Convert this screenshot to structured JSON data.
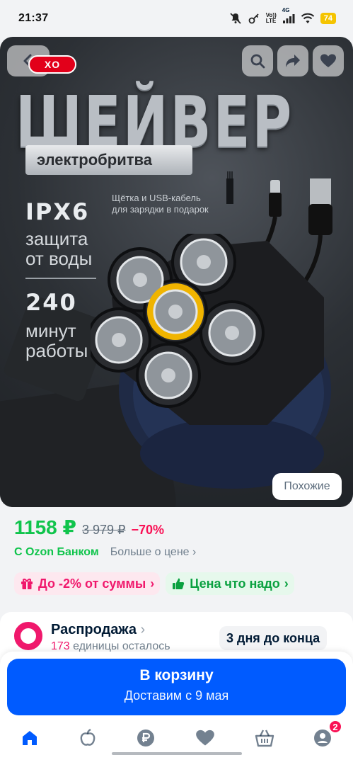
{
  "status_bar": {
    "time": "21:37",
    "network_top": "Vo))",
    "network_bottom": "LTE",
    "network_type": "4G",
    "battery": "74",
    "icons": [
      "mute-icon",
      "key-icon",
      "signal-icon",
      "wifi-icon",
      "battery-icon"
    ]
  },
  "product_image": {
    "brand": "XO",
    "title": "ШЕЙВЕР",
    "subtitle": "электробритва",
    "gift_note": "Щётка и USB-кабель для зарядки в подарок",
    "spec1_big": "IPX6",
    "spec1_line1": "защита",
    "spec1_line2": "от воды",
    "spec2_big": "240",
    "spec2_line1": "минут",
    "spec2_line2": "работы",
    "similar_label": "Похожие",
    "buttons": [
      "back-icon",
      "search-icon",
      "share-icon",
      "heart-icon"
    ]
  },
  "price": {
    "current": "1158 ₽",
    "old": "3 979 ₽",
    "discount": "−70%",
    "ozon_bank": "С Ozon Банком",
    "more": "Больше о цене"
  },
  "chips": [
    {
      "label": "До -2% от суммы",
      "icon": "gift-icon",
      "color": "#f0186c"
    },
    {
      "label": "Цена что надо",
      "icon": "thumbs-up-icon",
      "color": "#0aa140"
    }
  ],
  "sale": {
    "title": "Распродажа",
    "left_count": "173",
    "left_text": " единицы осталось",
    "timer": "3 дня до конца"
  },
  "cart": {
    "label": "В корзину",
    "delivery": "Доставим с 9 мая"
  },
  "tabbar": {
    "items": [
      "home-icon",
      "fresh-icon",
      "ruble-icon",
      "heart-icon",
      "basket-icon",
      "profile-icon"
    ],
    "profile_badge": "2"
  },
  "colors": {
    "accent": "#005bff",
    "price_green": "#10c44c",
    "sale_pink": "#f0186c"
  }
}
